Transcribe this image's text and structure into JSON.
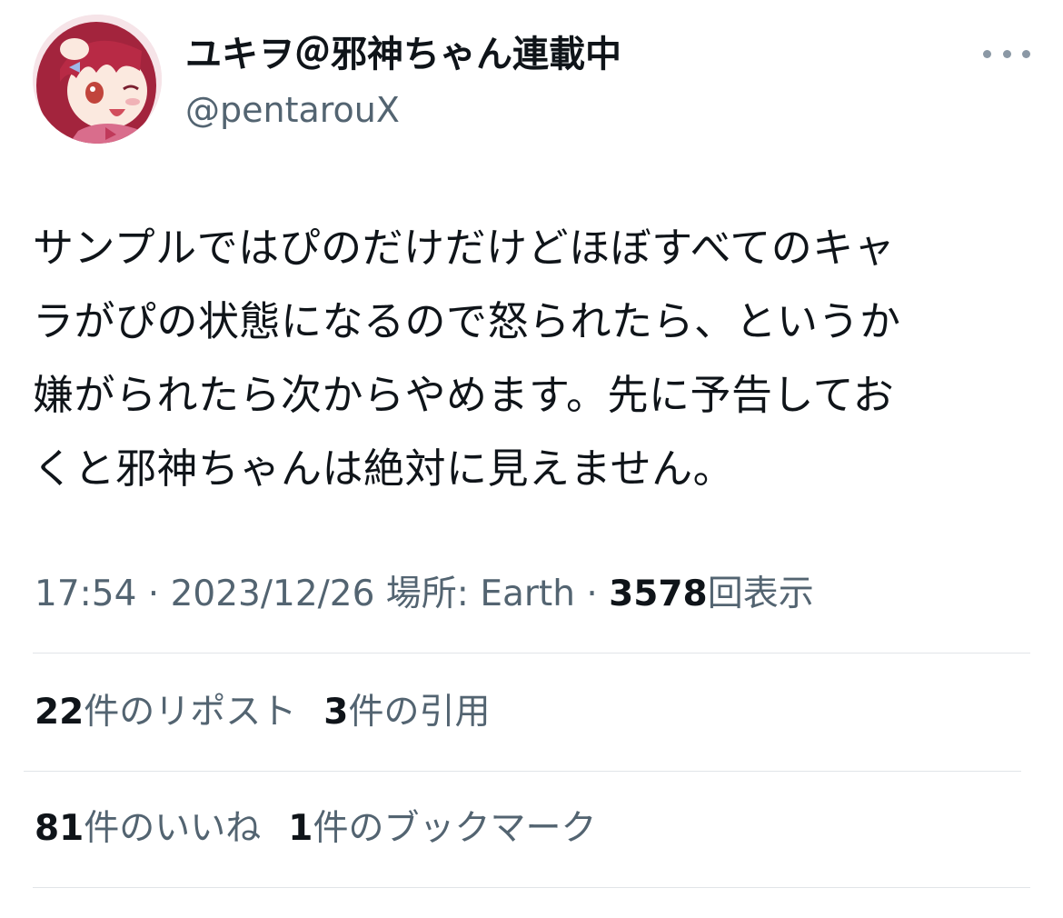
{
  "author": {
    "display_name": "ユキヲ＠邪神ちゃん連載中",
    "handle": "@pentarouX",
    "avatar_icon": "anime-girl-avatar-icon"
  },
  "menu": {
    "more_icon": "more-dots-icon"
  },
  "tweet": {
    "lines": [
      "サンプルではぴのだけだけどほぼすべてのキャ",
      "ラがぴの状態になるので怒られたら、というか",
      "嫌がられたら次からやめます。先に予告してお",
      "くと邪神ちゃんは絶対に見えません。"
    ]
  },
  "meta": {
    "time": "17:54",
    "sep1": " · ",
    "date": "2023/12/26",
    "location_label": " 場所: Earth",
    "sep2": " · ",
    "views": "3578",
    "views_label": "回表示"
  },
  "stats": {
    "reposts_count": "22",
    "reposts_label": "件のリポスト",
    "quotes_count": "3",
    "quotes_label": "件の引用",
    "likes_count": "81",
    "likes_label": "件のいいね",
    "bookmarks_count": "1",
    "bookmarks_label": "件のブックマーク"
  },
  "colors": {
    "primary_text": "#0f1419",
    "secondary_text": "#536471",
    "divider": "#e1e5e8"
  }
}
